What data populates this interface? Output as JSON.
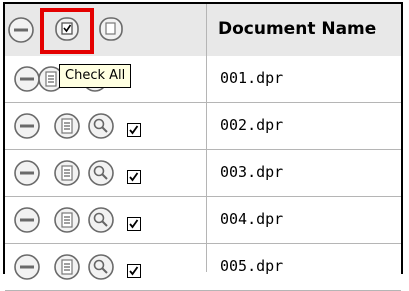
{
  "table": {
    "header_label": "Document Name",
    "rows": [
      {
        "name": "001.dpr",
        "checked": true
      },
      {
        "name": "002.dpr",
        "checked": true
      },
      {
        "name": "003.dpr",
        "checked": true
      },
      {
        "name": "004.dpr",
        "checked": true
      },
      {
        "name": "005.dpr",
        "checked": true
      }
    ]
  },
  "tooltip": {
    "text": "Check All"
  },
  "colors": {
    "highlight": "#e40000",
    "tooltip_bg": "#ffffe1",
    "header_bg": "#e8e8e8"
  },
  "icons": [
    "collapse-all-icon",
    "check-all-icon",
    "document-icon",
    "minus-icon",
    "properties-icon",
    "search-icon",
    "checkbox-icon"
  ]
}
